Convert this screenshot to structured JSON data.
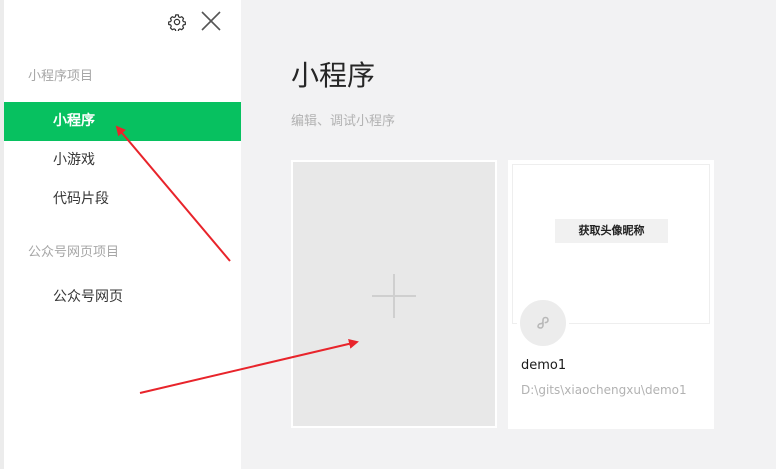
{
  "sidebar": {
    "sections": [
      {
        "title": "小程序项目",
        "items": [
          {
            "label": "小程序",
            "active": true
          },
          {
            "label": "小游戏",
            "active": false
          },
          {
            "label": "代码片段",
            "active": false
          }
        ]
      },
      {
        "title": "公众号网页项目",
        "items": [
          {
            "label": "公众号网页",
            "active": false
          }
        ]
      }
    ],
    "icons": {
      "settings": "gear-icon",
      "close": "close-icon"
    }
  },
  "main": {
    "title": "小程序",
    "subtitle": "编辑、调试小程序",
    "create_card": {
      "icon": "plus-icon"
    },
    "projects": [
      {
        "name": "demo1",
        "path": "D:\\gits\\xiaochengxu\\demo1",
        "preview_button": "获取头像昵称",
        "icon": "mini-program-logo-icon"
      }
    ]
  },
  "colors": {
    "accent": "#07c160",
    "annotation": "#e8242b"
  }
}
